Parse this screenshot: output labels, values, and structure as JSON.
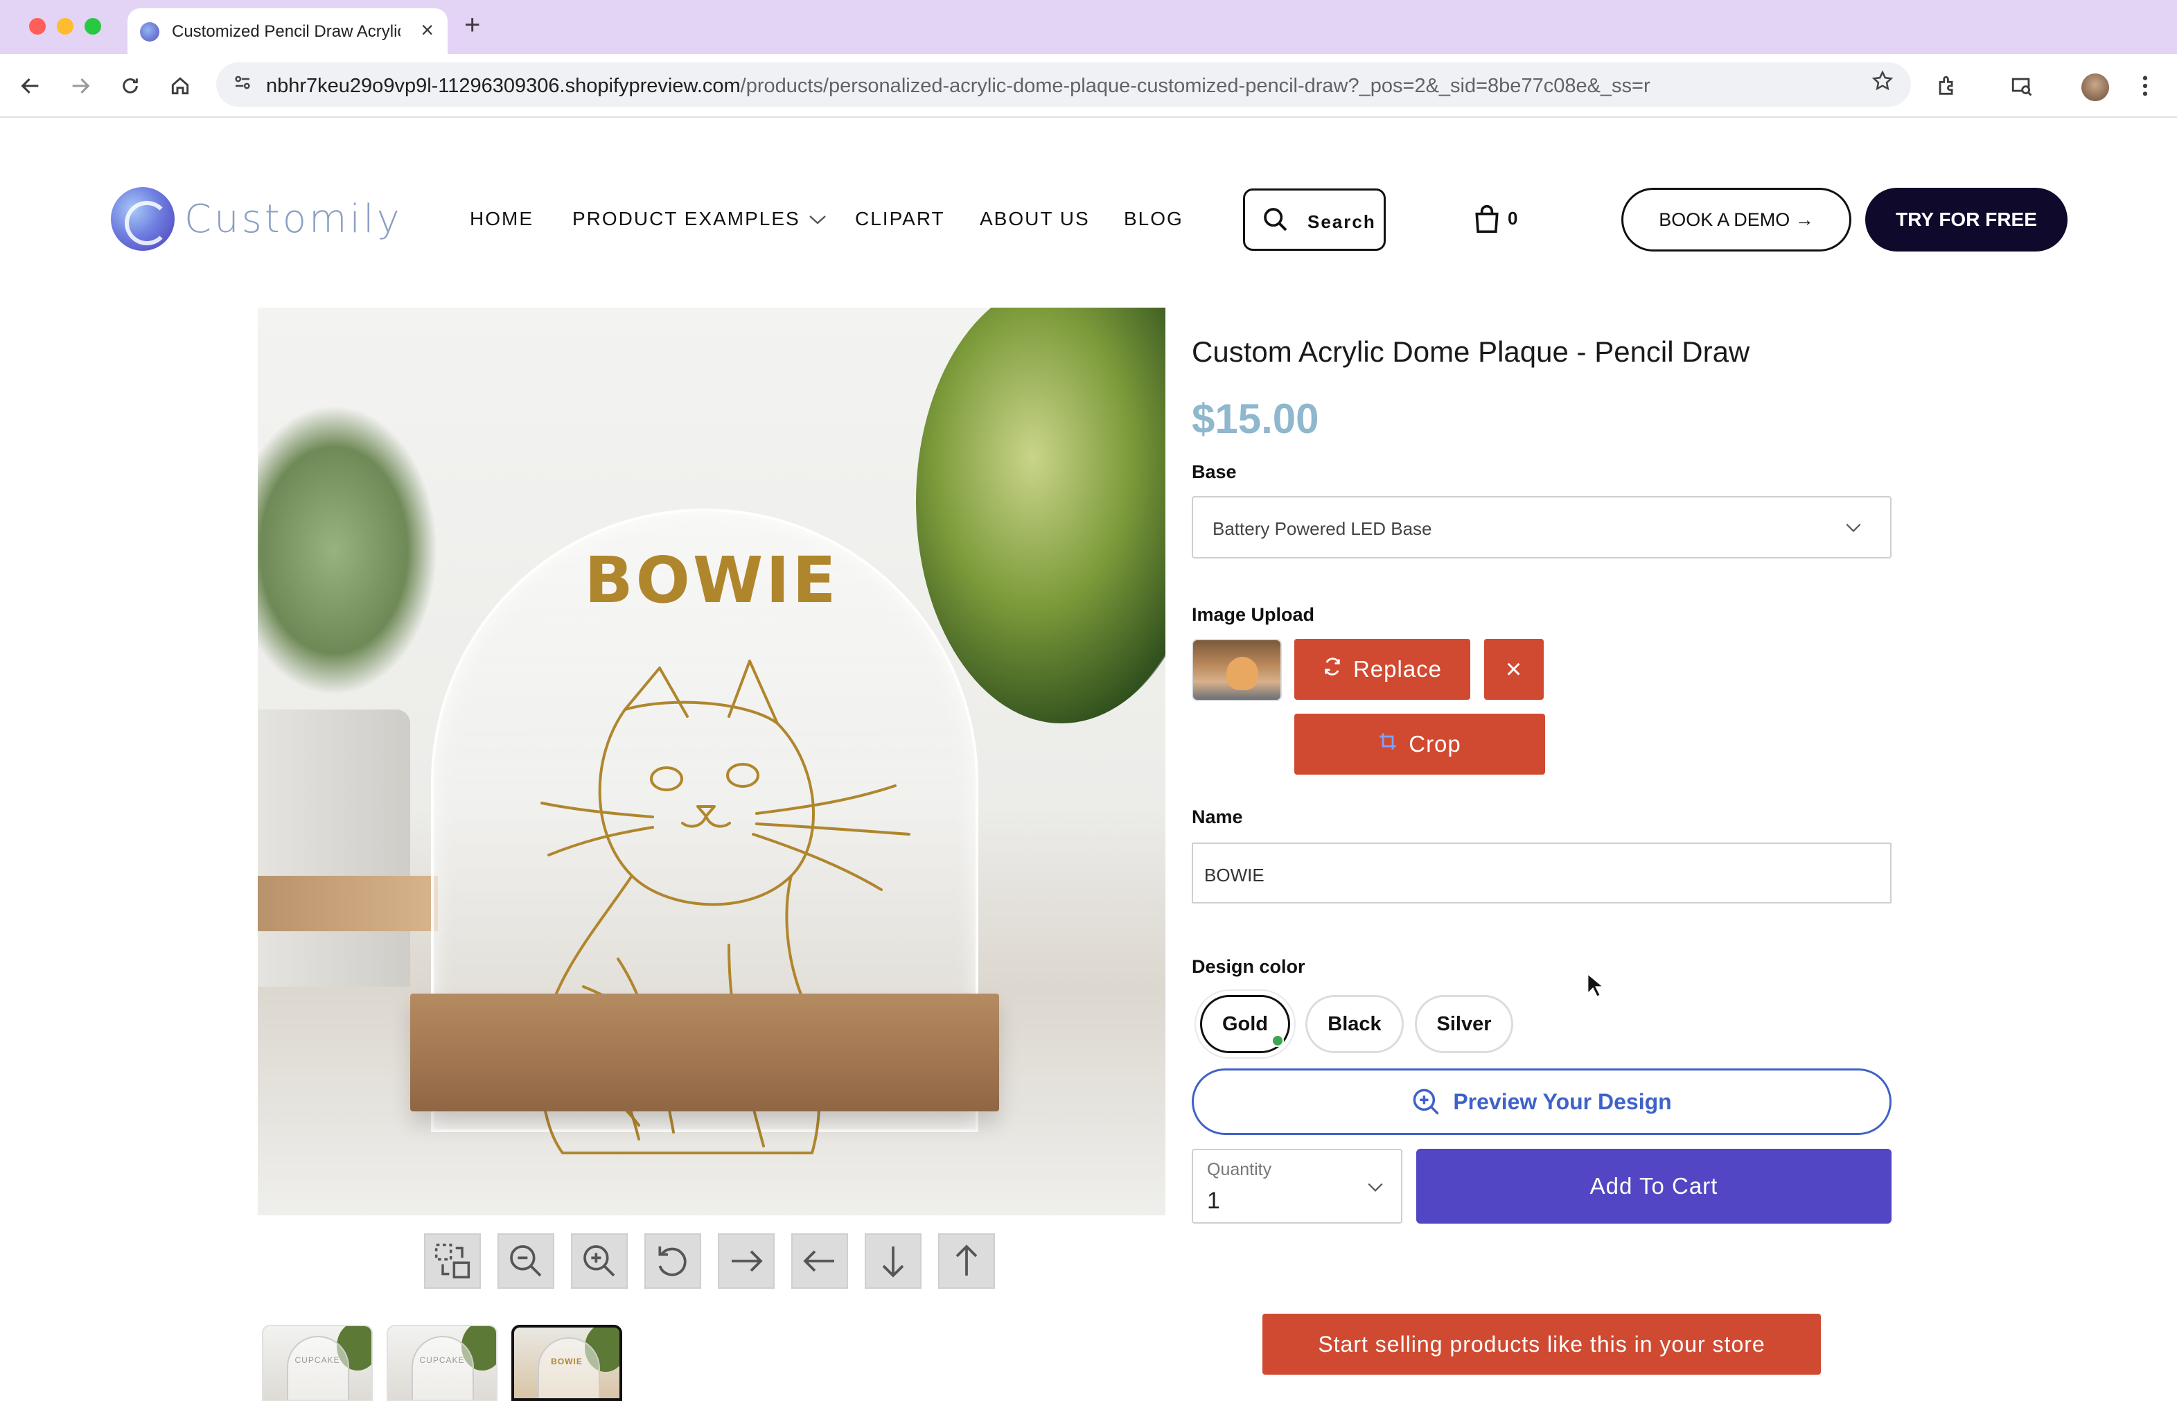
{
  "browser": {
    "tab_title": "Customized Pencil Draw Acrylic Dome Plaque",
    "tab_close": "×",
    "new_tab": "+",
    "url_host": "nbhr7keu29o9vp9l-11296309306.shopifypreview.com",
    "url_path": "/products/personalized-acrylic-dome-plaque-customized-pencil-draw?_pos=2&_sid=8be77c08e&_ss=r",
    "icons": [
      "back-icon",
      "forward-icon",
      "reload-icon",
      "home-icon",
      "site-info-icon",
      "star-icon",
      "extensions-icon",
      "tab-search-icon",
      "profile-avatar",
      "menu-icon"
    ]
  },
  "site": {
    "logo_text": "Customily",
    "nav": [
      {
        "label": "HOME"
      },
      {
        "label": "PRODUCT EXAMPLES"
      },
      {
        "label": "CLIPART"
      },
      {
        "label": "ABOUT US"
      },
      {
        "label": "BLOG"
      }
    ],
    "search_label": "Search",
    "cart_count": "0",
    "book_demo": "BOOK A DEMO →",
    "try_free": "TRY FOR FREE"
  },
  "product": {
    "image_text": "BOWIE",
    "title": "Custom Acrylic Dome Plaque - Pencil Draw",
    "price": "$15.00",
    "base_label": "Base",
    "base_value": "Battery Powered LED Base",
    "image_upload_label": "Image Upload",
    "replace_label": "Replace",
    "remove_label": "×",
    "crop_label": "Crop",
    "name_label": "Name",
    "name_value": "BOWIE",
    "design_color_label": "Design color",
    "colors": [
      {
        "label": "Gold",
        "selected": true
      },
      {
        "label": "Black",
        "selected": false
      },
      {
        "label": "Silver",
        "selected": false
      }
    ],
    "preview_label": "Preview Your Design",
    "quantity_label": "Quantity",
    "quantity_value": "1",
    "add_to_cart": "Add To Cart",
    "start_selling": "Start selling products like this in your store",
    "thumbnails": [
      {
        "text": "CUPCAKE"
      },
      {
        "text": "CUPCAKE"
      },
      {
        "text": "BOWIE"
      }
    ],
    "tools": [
      "select-area-icon",
      "zoom-out-icon",
      "zoom-in-icon",
      "rotate-icon",
      "move-right-icon",
      "move-left-icon",
      "move-down-icon",
      "move-up-icon"
    ]
  },
  "colors": {
    "accent_red": "#d04a32",
    "accent_purple": "#5346c4",
    "preview_blue": "#3f62c9",
    "price_blue": "#8fb7cd",
    "dark_navy": "#0f0a2c",
    "gold_engraving": "#b0862d"
  }
}
